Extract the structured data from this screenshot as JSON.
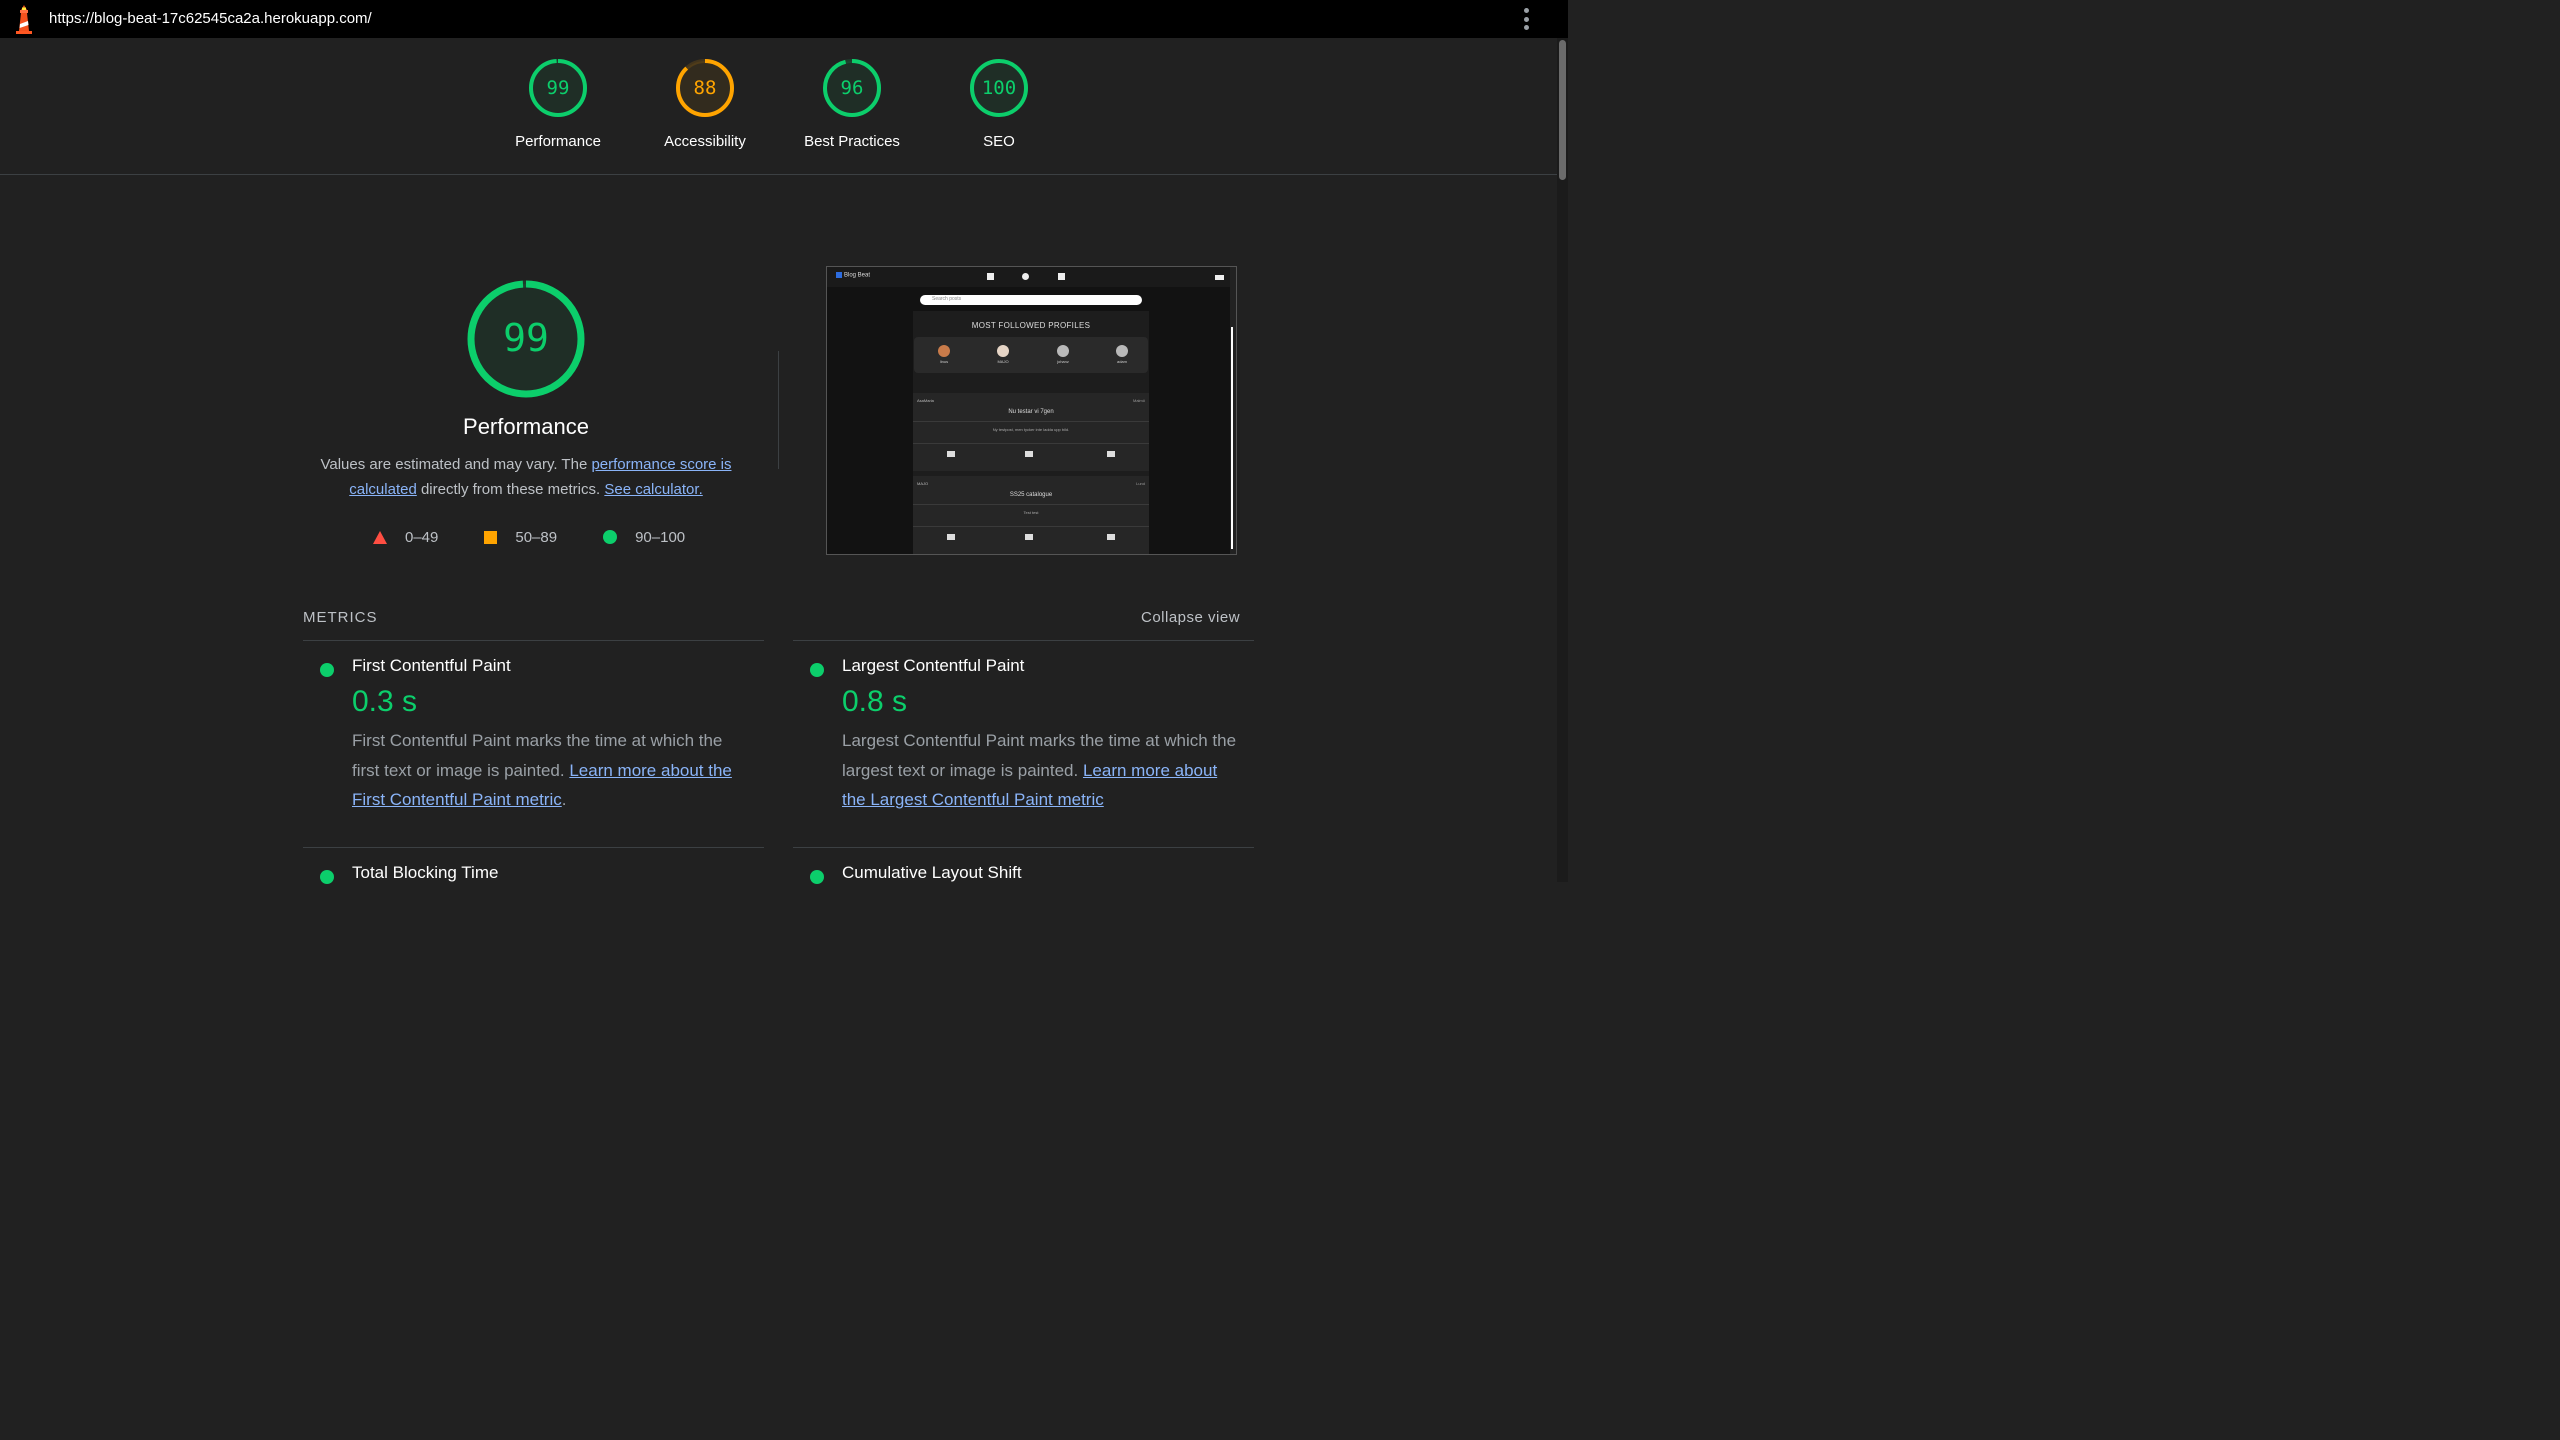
{
  "browser": {
    "url": "https://blog-beat-17c62545ca2a.herokuapp.com/"
  },
  "colors": {
    "pass": "#0cce6b",
    "average": "#ffa400",
    "fail": "#ff4e42",
    "link": "#8ab4f8",
    "background": "#212121"
  },
  "gauges": [
    {
      "score": "99",
      "label": "Performance",
      "status": "pass"
    },
    {
      "score": "88",
      "label": "Accessibility",
      "status": "average"
    },
    {
      "score": "96",
      "label": "Best Practices",
      "status": "pass"
    },
    {
      "score": "100",
      "label": "SEO",
      "status": "pass"
    }
  ],
  "performance": {
    "score": "99",
    "title": "Performance",
    "desc_part1": "Values are estimated and may vary. The ",
    "desc_link1": "performance score is calculated",
    "desc_part2": " directly from these metrics. ",
    "desc_link2": "See calculator.",
    "legend": [
      {
        "range": "0–49",
        "shape": "triangle"
      },
      {
        "range": "50–89",
        "shape": "square"
      },
      {
        "range": "90–100",
        "shape": "circle"
      }
    ]
  },
  "thumbnail": {
    "brand": "Blog Beat",
    "search_placeholder": "Search posts",
    "section_title": "MOST FOLLOWED PROFILES",
    "profiles": [
      "linus",
      "MAJO",
      "johanz",
      "adam"
    ],
    "posts": [
      {
        "author": "AsaMaria",
        "location": "Malmö",
        "title": "Nu testar vi 7gen",
        "body": "Ny testpost, men tycker inte ladda upp bild.",
        "likes": "0",
        "comments": "1"
      },
      {
        "author": "MAJO",
        "location": "Lund",
        "title": "SS25 catalogue",
        "body": "Test test",
        "likes": "1",
        "comments": "2"
      }
    ]
  },
  "metrics": {
    "heading": "METRICS",
    "collapse_label": "Collapse view",
    "items": [
      {
        "title": "First Contentful Paint",
        "value": "0.3 s",
        "desc": "First Contentful Paint marks the time at which the first text or image is painted. ",
        "link": "Learn more about the First Contentful Paint metric",
        "after": "."
      },
      {
        "title": "Largest Contentful Paint",
        "value": "0.8 s",
        "desc": "Largest Contentful Paint marks the time at which the largest text or image is painted. ",
        "link": "Learn more about the Largest Contentful Paint metric",
        "after": ""
      },
      {
        "title": "Total Blocking Time"
      },
      {
        "title": "Cumulative Layout Shift"
      }
    ]
  }
}
